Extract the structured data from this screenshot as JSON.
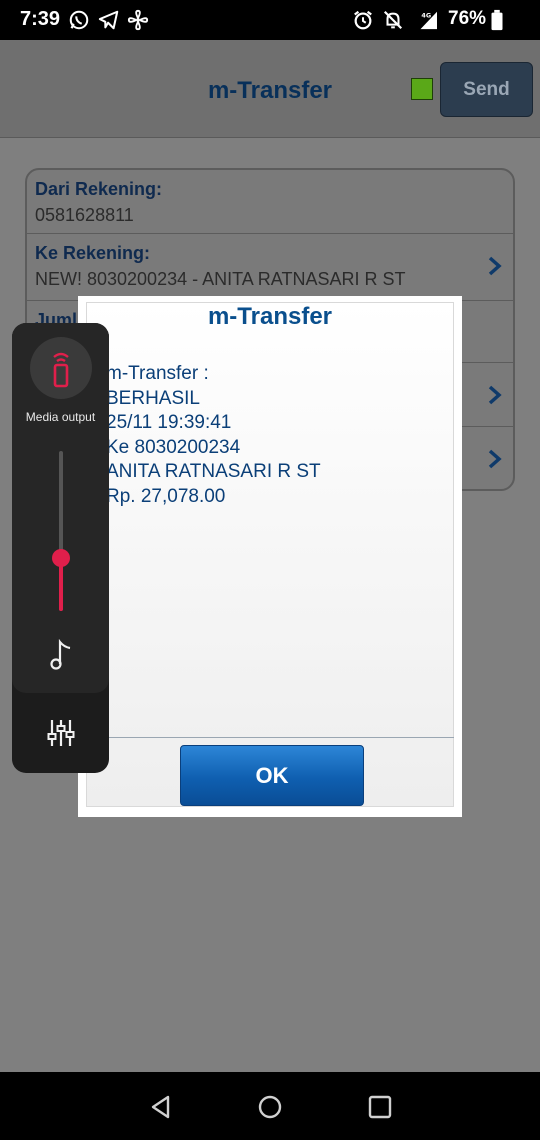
{
  "status_bar": {
    "time": "7:39",
    "battery_percent": "76%",
    "left_icons": [
      "whatsapp-icon",
      "telegram-icon",
      "fan-icon"
    ],
    "right_icons": [
      "alarm-icon",
      "notifications-off-icon",
      "signal-4g-icon",
      "battery-icon"
    ],
    "network_label": "4G"
  },
  "header": {
    "title": "m-Transfer",
    "send_label": "Send",
    "status_color": "#5aa818"
  },
  "form": {
    "from_label": "Dari Rekening:",
    "from_value": "0581628811",
    "to_label": "Ke Rekening:",
    "to_value": "NEW! 8030200234 - ANITA RATNASARI R ST",
    "amount_label_partial": "Juml"
  },
  "dialog": {
    "title": "m-Transfer",
    "lines": [
      "m-Transfer :",
      "BERHASIL",
      "25/11 19:39:41",
      "Ke 8030200234",
      "ANITA RATNASARI R ST",
      "Rp. 27,078.00"
    ],
    "ok_label": "OK"
  },
  "volume_panel": {
    "media_output_label": "Media output",
    "volume_level": 0.33,
    "accent_color": "#e01f4b"
  },
  "nav_bar": {
    "buttons": [
      "back-icon",
      "home-icon",
      "recents-icon"
    ]
  }
}
